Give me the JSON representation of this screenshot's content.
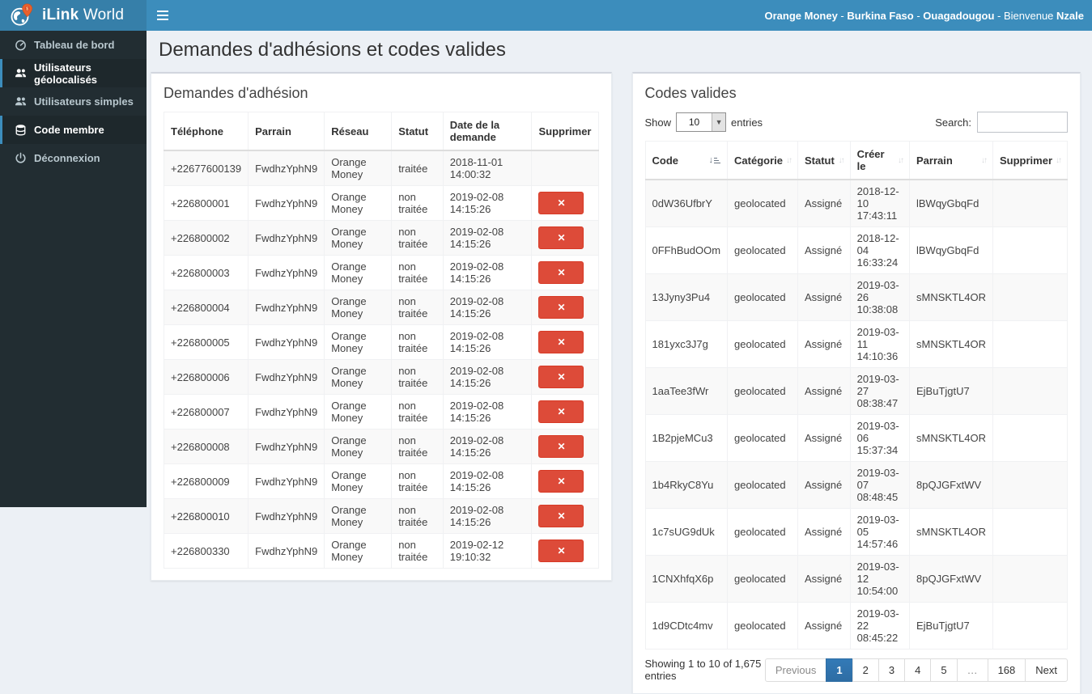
{
  "topbar": {
    "brand_bold": "iLink",
    "brand_rest": " World",
    "right": {
      "network": "Orange Money",
      "sep1": " - ",
      "country": "Burkina Faso",
      "sep2": " - ",
      "city": "Ouagadougou",
      "sep3": " - ",
      "greeting": "Bienvenue ",
      "user": "Nzale"
    }
  },
  "sidebar": {
    "items": [
      {
        "label": "Tableau de bord",
        "icon": "dashboard-icon"
      },
      {
        "label": "Utilisateurs géolocalisés",
        "icon": "users-icon"
      },
      {
        "label": "Utilisateurs simples",
        "icon": "users-icon"
      },
      {
        "label": "Code membre",
        "icon": "database-icon"
      },
      {
        "label": "Déconnexion",
        "icon": "power-icon"
      }
    ]
  },
  "page": {
    "title": "Demandes d'adhésions et codes valides"
  },
  "adhesion_panel": {
    "title": "Demandes d'adhésion",
    "columns": {
      "telephone": "Téléphone",
      "parrain": "Parrain",
      "reseau": "Réseau",
      "statut": "Statut",
      "date": "Date de la demande",
      "supprimer": "Supprimer"
    },
    "delete_glyph": "✕",
    "rows": [
      {
        "telephone": "+22677600139",
        "parrain": "FwdhzYphN9",
        "reseau": "Orange Money",
        "statut": "traitée",
        "date": "2018-11-01 14:00:32",
        "deletable": false
      },
      {
        "telephone": "+226800001",
        "parrain": "FwdhzYphN9",
        "reseau": "Orange Money",
        "statut": "non traitée",
        "date": "2019-02-08 14:15:26",
        "deletable": true
      },
      {
        "telephone": "+226800002",
        "parrain": "FwdhzYphN9",
        "reseau": "Orange Money",
        "statut": "non traitée",
        "date": "2019-02-08 14:15:26",
        "deletable": true
      },
      {
        "telephone": "+226800003",
        "parrain": "FwdhzYphN9",
        "reseau": "Orange Money",
        "statut": "non traitée",
        "date": "2019-02-08 14:15:26",
        "deletable": true
      },
      {
        "telephone": "+226800004",
        "parrain": "FwdhzYphN9",
        "reseau": "Orange Money",
        "statut": "non traitée",
        "date": "2019-02-08 14:15:26",
        "deletable": true
      },
      {
        "telephone": "+226800005",
        "parrain": "FwdhzYphN9",
        "reseau": "Orange Money",
        "statut": "non traitée",
        "date": "2019-02-08 14:15:26",
        "deletable": true
      },
      {
        "telephone": "+226800006",
        "parrain": "FwdhzYphN9",
        "reseau": "Orange Money",
        "statut": "non traitée",
        "date": "2019-02-08 14:15:26",
        "deletable": true
      },
      {
        "telephone": "+226800007",
        "parrain": "FwdhzYphN9",
        "reseau": "Orange Money",
        "statut": "non traitée",
        "date": "2019-02-08 14:15:26",
        "deletable": true
      },
      {
        "telephone": "+226800008",
        "parrain": "FwdhzYphN9",
        "reseau": "Orange Money",
        "statut": "non traitée",
        "date": "2019-02-08 14:15:26",
        "deletable": true
      },
      {
        "telephone": "+226800009",
        "parrain": "FwdhzYphN9",
        "reseau": "Orange Money",
        "statut": "non traitée",
        "date": "2019-02-08 14:15:26",
        "deletable": true
      },
      {
        "telephone": "+226800010",
        "parrain": "FwdhzYphN9",
        "reseau": "Orange Money",
        "statut": "non traitée",
        "date": "2019-02-08 14:15:26",
        "deletable": true
      },
      {
        "telephone": "+226800330",
        "parrain": "FwdhzYphN9",
        "reseau": "Orange Money",
        "statut": "non traitée",
        "date": "2019-02-12 19:10:32",
        "deletable": true
      }
    ]
  },
  "codes_panel": {
    "title": "Codes valides",
    "length_control": {
      "show_label": "Show",
      "value": "10",
      "entries_label": "entries"
    },
    "search": {
      "label": "Search:",
      "value": ""
    },
    "columns": {
      "code": "Code",
      "categorie": "Catégorie",
      "statut": "Statut",
      "creer_le": "Créer le",
      "parrain": "Parrain",
      "supprimer": "Supprimer"
    },
    "sort_state": {
      "code": "ascending",
      "others": "unsorted"
    },
    "rows": [
      {
        "code": "0dW36UfbrY",
        "categorie": "geolocated",
        "statut": "Assigné",
        "creer_le": "2018-12-10 17:43:11",
        "parrain": "lBWqyGbqFd"
      },
      {
        "code": "0FFhBudOOm",
        "categorie": "geolocated",
        "statut": "Assigné",
        "creer_le": "2018-12-04 16:33:24",
        "parrain": "lBWqyGbqFd"
      },
      {
        "code": "13Jyny3Pu4",
        "categorie": "geolocated",
        "statut": "Assigné",
        "creer_le": "2019-03-26 10:38:08",
        "parrain": "sMNSKTL4OR"
      },
      {
        "code": "181yxc3J7g",
        "categorie": "geolocated",
        "statut": "Assigné",
        "creer_le": "2019-03-11 14:10:36",
        "parrain": "sMNSKTL4OR"
      },
      {
        "code": "1aaTee3fWr",
        "categorie": "geolocated",
        "statut": "Assigné",
        "creer_le": "2019-03-27 08:38:47",
        "parrain": "EjBuTjgtU7"
      },
      {
        "code": "1B2pjeMCu3",
        "categorie": "geolocated",
        "statut": "Assigné",
        "creer_le": "2019-03-06 15:37:34",
        "parrain": "sMNSKTL4OR"
      },
      {
        "code": "1b4RkyC8Yu",
        "categorie": "geolocated",
        "statut": "Assigné",
        "creer_le": "2019-03-07 08:48:45",
        "parrain": "8pQJGFxtWV"
      },
      {
        "code": "1c7sUG9dUk",
        "categorie": "geolocated",
        "statut": "Assigné",
        "creer_le": "2019-03-05 14:57:46",
        "parrain": "sMNSKTL4OR"
      },
      {
        "code": "1CNXhfqX6p",
        "categorie": "geolocated",
        "statut": "Assigné",
        "creer_le": "2019-03-12 10:54:00",
        "parrain": "8pQJGFxtWV"
      },
      {
        "code": "1d9CDtc4mv",
        "categorie": "geolocated",
        "statut": "Assigné",
        "creer_le": "2019-03-22 08:45:22",
        "parrain": "EjBuTjgtU7"
      }
    ],
    "footer": {
      "info": "Showing 1 to 10 of 1,675 entries",
      "pagination": [
        {
          "label": "Previous",
          "state": "disabled"
        },
        {
          "label": "1",
          "state": "active"
        },
        {
          "label": "2"
        },
        {
          "label": "3"
        },
        {
          "label": "4"
        },
        {
          "label": "5"
        },
        {
          "label": "…",
          "state": "disabled"
        },
        {
          "label": "168"
        },
        {
          "label": "Next"
        }
      ]
    }
  },
  "colors": {
    "navbar": "#3c8dbc",
    "brand_bg": "#367fa9",
    "sidebar_bg": "#222d32",
    "sidebar_active_bg": "#1e282c",
    "content_bg": "#ecf0f5",
    "danger_button": "#dd4b39",
    "pagination_active": "#337ab7",
    "stripe": "#f9f9f9"
  }
}
